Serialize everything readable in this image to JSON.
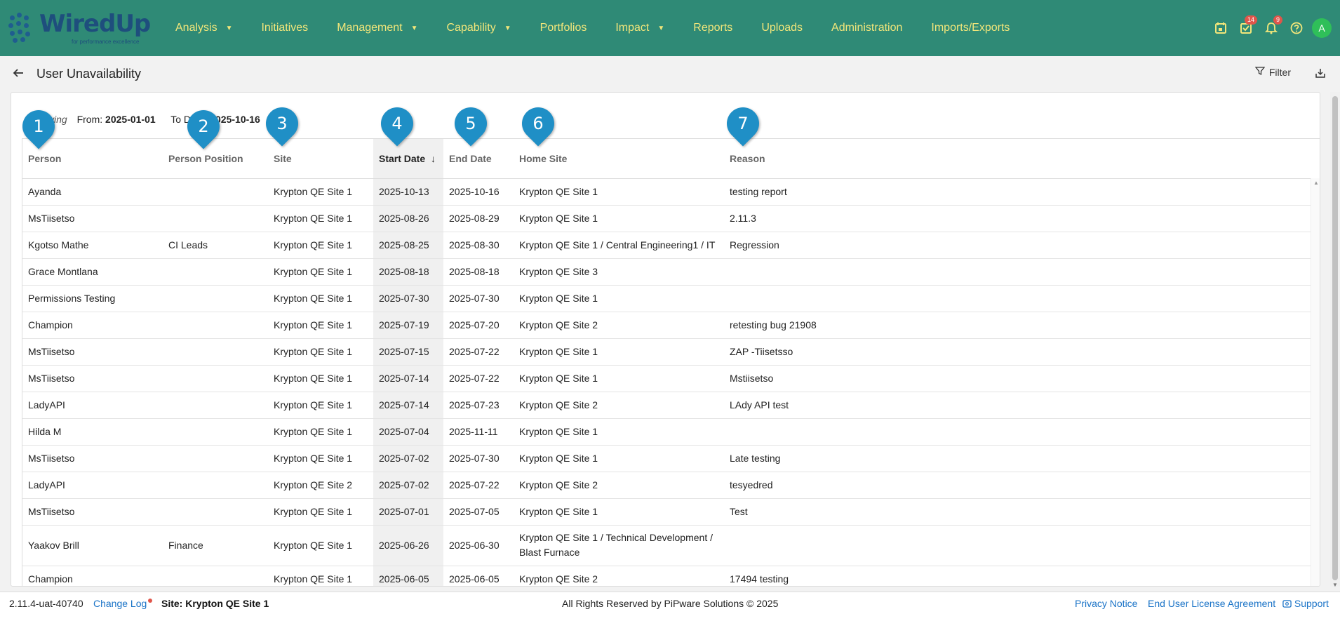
{
  "app": {
    "logo_text": "WiredUp",
    "logo_tagline": "for performance excellence"
  },
  "nav": [
    {
      "label": "Analysis",
      "has_caret": true
    },
    {
      "label": "Initiatives",
      "has_caret": false
    },
    {
      "label": "Management",
      "has_caret": true
    },
    {
      "label": "Capability",
      "has_caret": true
    },
    {
      "label": "Portfolios",
      "has_caret": false
    },
    {
      "label": "Impact",
      "has_caret": true
    },
    {
      "label": "Reports",
      "has_caret": false
    },
    {
      "label": "Uploads",
      "has_caret": false
    },
    {
      "label": "Administration",
      "has_caret": false
    },
    {
      "label": "Imports/Exports",
      "has_caret": false
    }
  ],
  "top_icons": {
    "tasks_badge": "14",
    "notifications_badge": "9",
    "avatar_initial": "A"
  },
  "page": {
    "title": "User Unavailability",
    "filter_label": "Filter"
  },
  "showing": {
    "label": "Showing",
    "from_label": "From:",
    "from_value": "2025-01-01",
    "to_label": "To Date:",
    "to_value": "2025-10-16"
  },
  "table": {
    "columns": [
      "Person",
      "Person Position",
      "Site",
      "Start Date",
      "End Date",
      "Home Site",
      "Reason"
    ],
    "sorted_column": "Start Date",
    "sort_direction": "descending",
    "rows": [
      [
        "Ayanda",
        "",
        "Krypton QE Site 1",
        "2025-10-13",
        "2025-10-16",
        "Krypton QE Site 1",
        "testing report"
      ],
      [
        "MsTiisetso",
        "",
        "Krypton QE Site 1",
        "2025-08-26",
        "2025-08-29",
        "Krypton QE Site 1",
        "2.11.3"
      ],
      [
        "Kgotso Mathe",
        "CI Leads",
        "Krypton QE Site 1",
        "2025-08-25",
        "2025-08-30",
        "Krypton QE Site 1 / Central Engineering1 / IT",
        "Regression"
      ],
      [
        "Grace Montlana",
        "",
        "Krypton QE Site 1",
        "2025-08-18",
        "2025-08-18",
        "Krypton QE Site 3",
        ""
      ],
      [
        "Permissions Testing",
        "",
        "Krypton QE Site 1",
        "2025-07-30",
        "2025-07-30",
        "Krypton QE Site 1",
        ""
      ],
      [
        "Champion",
        "",
        "Krypton QE Site 1",
        "2025-07-19",
        "2025-07-20",
        "Krypton QE Site 2",
        "retesting bug 21908"
      ],
      [
        "MsTiisetso",
        "",
        "Krypton QE Site 1",
        "2025-07-15",
        "2025-07-22",
        "Krypton QE Site 1",
        "ZAP -Tiisetsso"
      ],
      [
        "MsTiisetso",
        "",
        "Krypton QE Site 1",
        "2025-07-14",
        "2025-07-22",
        "Krypton QE Site 1",
        "Mstiisetso"
      ],
      [
        "LadyAPI",
        "",
        "Krypton QE Site 1",
        "2025-07-14",
        "2025-07-23",
        "Krypton QE Site 2",
        "LAdy API test"
      ],
      [
        "Hilda M",
        "",
        "Krypton QE Site 1",
        "2025-07-04",
        "2025-11-11",
        "Krypton QE Site 1",
        ""
      ],
      [
        "MsTiisetso",
        "",
        "Krypton QE Site 1",
        "2025-07-02",
        "2025-07-30",
        "Krypton QE Site 1",
        "Late testing"
      ],
      [
        "LadyAPI",
        "",
        "Krypton QE Site 2",
        "2025-07-02",
        "2025-07-22",
        "Krypton QE Site 2",
        "tesyedred"
      ],
      [
        "MsTiisetso",
        "",
        "Krypton QE Site 1",
        "2025-07-01",
        "2025-07-05",
        "Krypton QE Site 1",
        "Test"
      ],
      [
        "Yaakov Brill",
        "Finance",
        "Krypton QE Site 1",
        "2025-06-26",
        "2025-06-30",
        "Krypton QE Site 1 / Technical Development / Blast Furnace",
        ""
      ],
      [
        "Champion",
        "",
        "Krypton QE Site 1",
        "2025-06-05",
        "2025-06-05",
        "Krypton QE Site 2",
        "17494 testing"
      ]
    ]
  },
  "markers": [
    "1",
    "2",
    "3",
    "4",
    "5",
    "6",
    "7"
  ],
  "footer": {
    "version": "2.11.4-uat-40740",
    "change_log": "Change Log",
    "site": "Site: Krypton QE Site 1",
    "rights": "All Rights Reserved by PiPware Solutions © 2025",
    "privacy": "Privacy Notice",
    "eula": "End User License Agreement",
    "support": "Support"
  },
  "colors": {
    "topbar": "#2f8a76",
    "nav_text": "#f2e67a",
    "marker": "#1f8fc6",
    "link": "#1a73c7"
  },
  "icons": [
    "calendar-icon",
    "tasks-icon",
    "bell-icon",
    "help-icon",
    "back-arrow-icon",
    "filter-icon",
    "export-icon",
    "sort-down-icon",
    "support-icon"
  ]
}
